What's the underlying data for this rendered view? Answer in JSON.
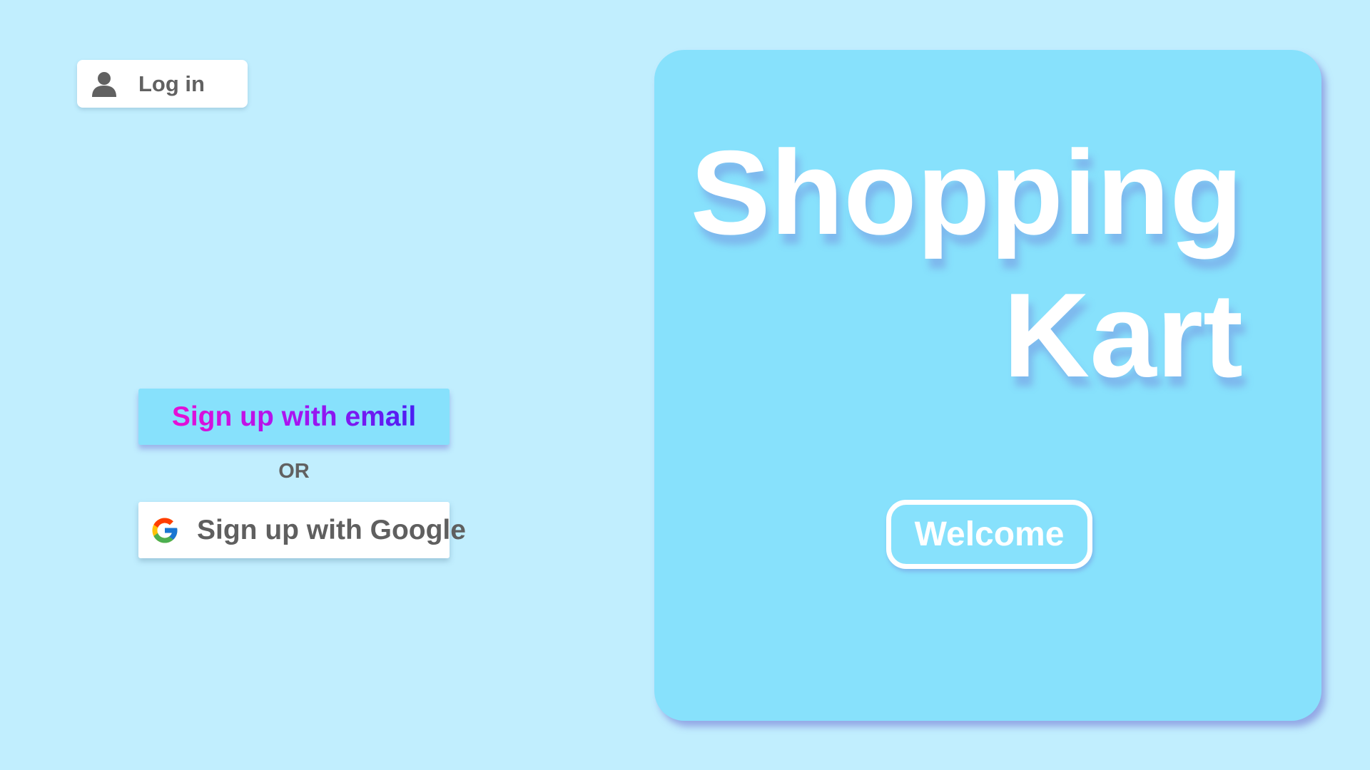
{
  "login": {
    "label": "Log in",
    "icon": "user-icon"
  },
  "signup": {
    "email_label": "Sign up with email",
    "or_text": "OR",
    "google_label": "Sign up with Google",
    "google_icon": "google-icon"
  },
  "hero": {
    "title_line1": "Shopping",
    "title_line2": "Kart",
    "welcome_label": "Welcome"
  },
  "colors": {
    "background": "#c1eefe",
    "card": "#87e1fc",
    "text_gray": "#616161",
    "gradient_start": "#e60fd5",
    "gradient_end": "#4a1ef2"
  }
}
